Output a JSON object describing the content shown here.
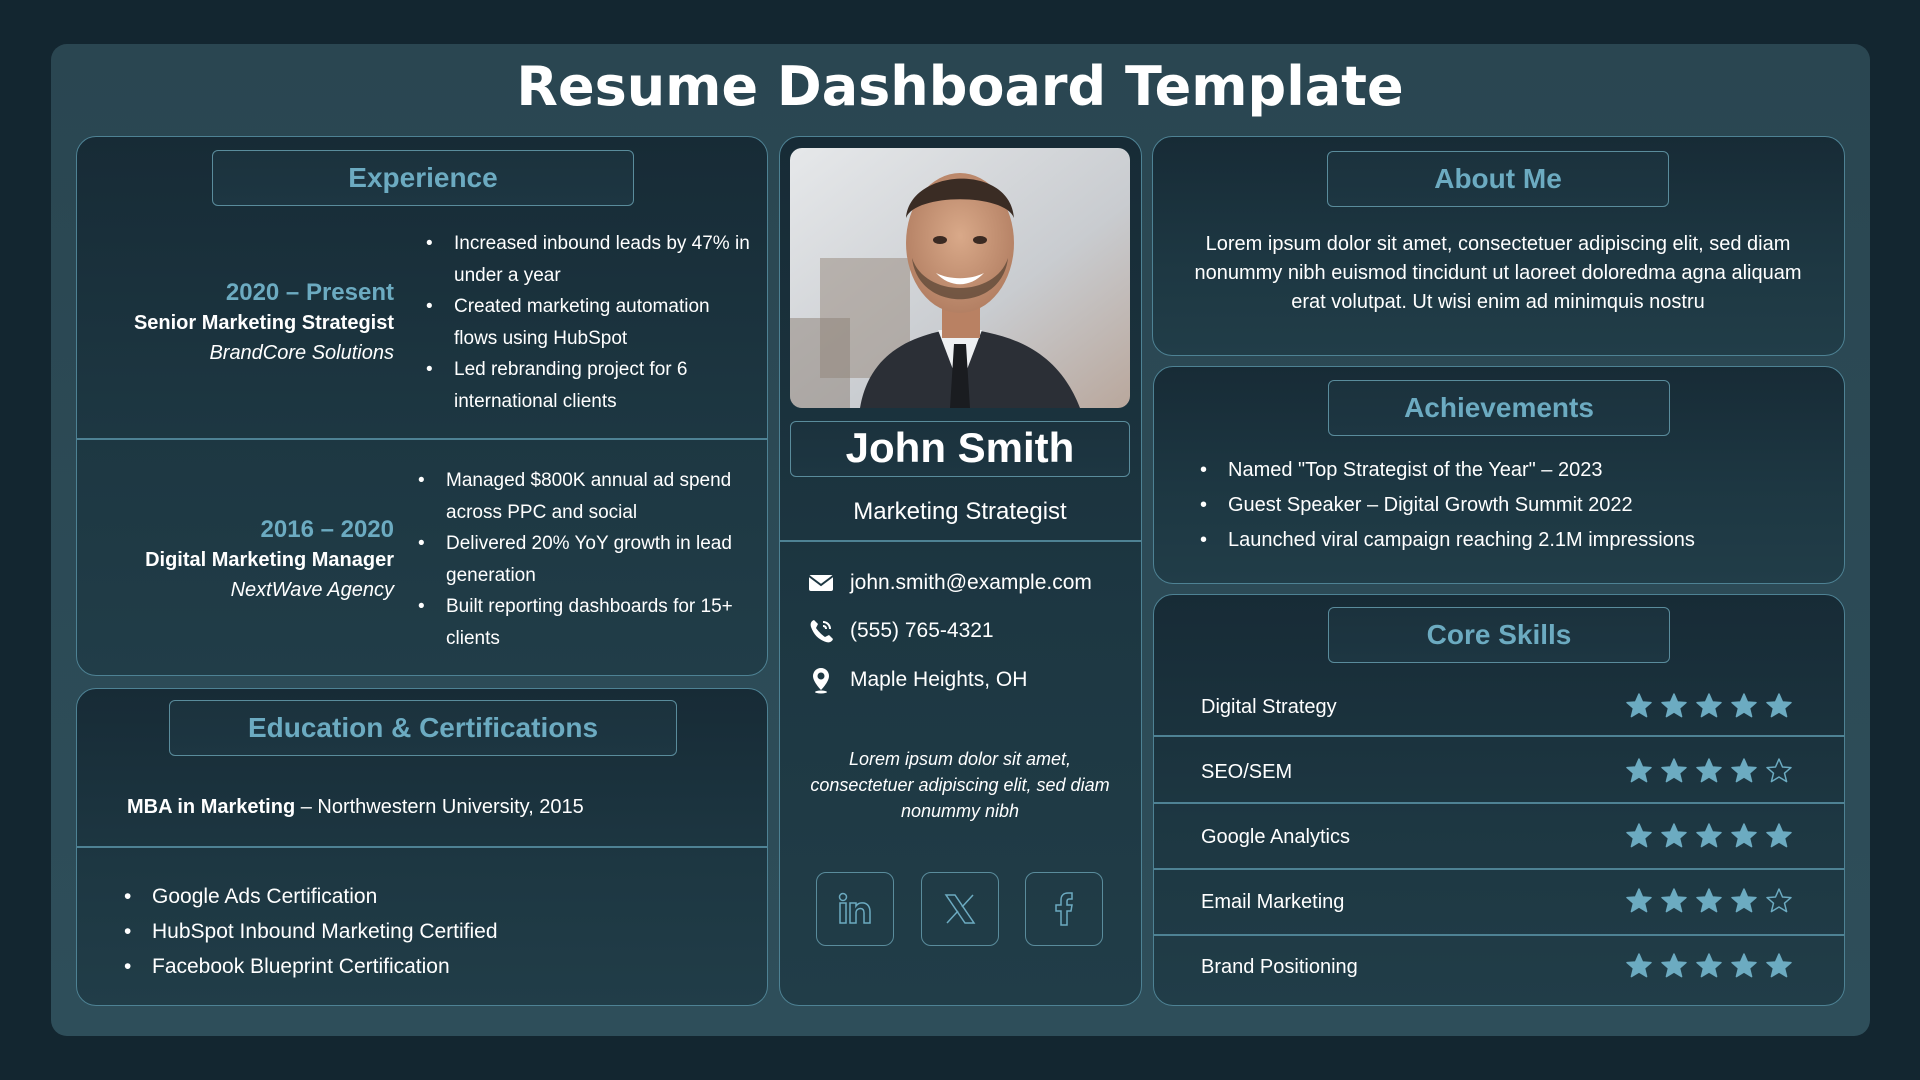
{
  "page_title": "Resume Dashboard Template",
  "experience": {
    "heading": "Experience",
    "jobs": [
      {
        "years": "2020 – Present",
        "role": "Senior Marketing Strategist",
        "company": "BrandCore Solutions",
        "bullets": [
          "Increased inbound leads by 47% in under a year",
          "Created marketing automation flows using HubSpot",
          "Led rebranding project for 6 international clients"
        ]
      },
      {
        "years": "2016 – 2020",
        "role": "Digital Marketing Manager",
        "company": "NextWave Agency",
        "bullets": [
          "Managed $800K annual ad spend across PPC and social",
          "Delivered 20% YoY growth in lead generation",
          "Built reporting dashboards for 15+ clients"
        ]
      }
    ]
  },
  "education": {
    "heading": "Education & Certifications",
    "degree": "MBA in Marketing",
    "degree_detail": " – Northwestern University, 2015",
    "certifications": [
      "Google Ads Certification",
      "HubSpot Inbound Marketing Certified",
      "Facebook Blueprint Certification"
    ]
  },
  "profile": {
    "name": "John Smith",
    "title": "Marketing Strategist",
    "email": "john.smith@example.com",
    "phone": "(555) 765-4321",
    "location": "Maple Heights, OH",
    "quote": "Lorem ipsum dolor sit amet, consectetuer adipiscing elit, sed diam nonummy nibh",
    "social": [
      "linkedin-icon",
      "x-icon",
      "facebook-icon"
    ]
  },
  "about": {
    "heading": "About Me",
    "text": "Lorem ipsum dolor sit amet, consectetuer adipiscing elit, sed diam nonummy nibh euismod tincidunt ut laoreet doloredma agna aliquam erat volutpat. Ut wisi enim ad minimquis nostru"
  },
  "achievements": {
    "heading": "Achievements",
    "items": [
      "Named \"Top Strategist of the Year\" – 2023",
      "Guest Speaker – Digital Growth Summit 2022",
      "Launched viral campaign reaching 2.1M impressions"
    ]
  },
  "skills": {
    "heading": "Core Skills",
    "max_rating": 5,
    "items": [
      {
        "name": "Digital Strategy",
        "rating": 5
      },
      {
        "name": "SEO/SEM",
        "rating": 4
      },
      {
        "name": "Google Analytics",
        "rating": 5
      },
      {
        "name": "Email Marketing",
        "rating": 4
      },
      {
        "name": "Brand Positioning",
        "rating": 5
      }
    ]
  },
  "colors": {
    "background": "#132630",
    "frame": "#2c4a56",
    "accent": "#6cabc1",
    "border": "#4e8294",
    "star": "#6cabc1"
  }
}
